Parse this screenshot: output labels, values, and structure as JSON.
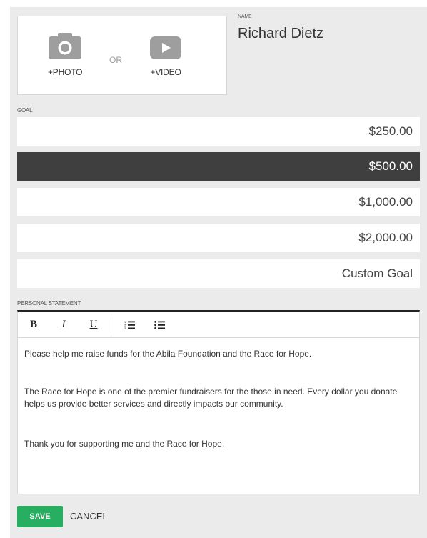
{
  "media": {
    "photo_label": "+PHOTO",
    "or_label": "OR",
    "video_label": "+VIDEO"
  },
  "name": {
    "label": "NAME",
    "value": "Richard Dietz"
  },
  "goal": {
    "label": "GOAL",
    "options": [
      "$250.00",
      "$500.00",
      "$1,000.00",
      "$2,000.00",
      "Custom Goal"
    ],
    "selected": "$500.00"
  },
  "statement": {
    "label": "PERSONAL STATEMENT",
    "toolbar": {
      "bold": "B",
      "italic": "I",
      "underline": "U"
    },
    "paragraphs": [
      "Please help me raise funds for the Abila Foundation and the Race for Hope.",
      "The Race for Hope is one of the premier fundraisers for the those in need.  Every dollar you donate helps us provide better services and directly impacts our community.",
      "Thank you for supporting me and the Race for Hope."
    ]
  },
  "actions": {
    "save": "SAVE",
    "cancel": "CANCEL"
  },
  "colors": {
    "save_button": "#27ae60",
    "selected_goal": "#3f3f3f",
    "icon_gray": "#9e9e9e"
  }
}
